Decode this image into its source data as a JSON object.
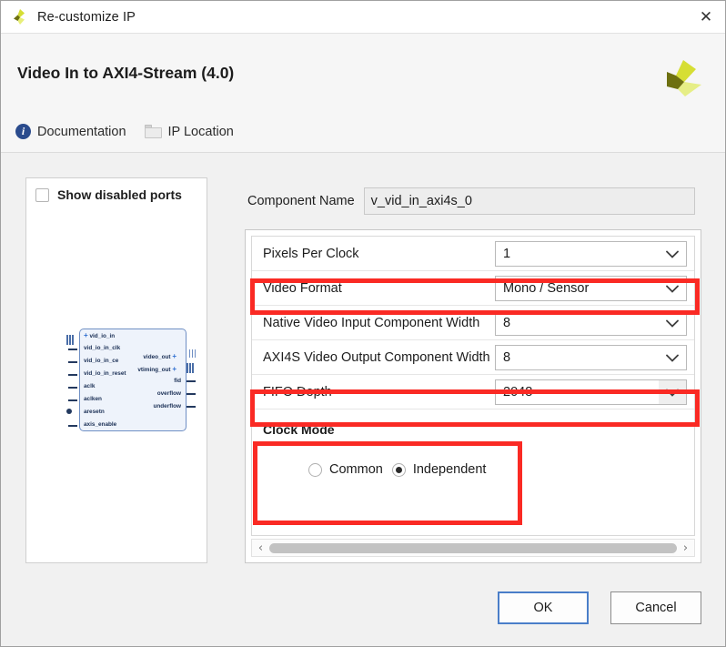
{
  "window": {
    "title": "Re-customize IP",
    "close_label": "✕",
    "logo_icon": "xilinx-logo-icon"
  },
  "header": {
    "ip_title": "Video In to AXI4-Stream (4.0)",
    "brand_icon": "xilinx-brand-icon",
    "links": [
      {
        "label": "Documentation",
        "icon": "info-icon"
      },
      {
        "label": "IP Location",
        "icon": "folder-icon"
      }
    ]
  },
  "left_panel": {
    "show_disabled_ports": {
      "label": "Show disabled ports",
      "checked": false
    },
    "diagram": {
      "inputs": [
        "vid_io_in",
        "vid_io_in_clk",
        "vid_io_in_ce",
        "vid_io_in_reset",
        "aclk",
        "aclken",
        "aresetn",
        "axis_enable"
      ],
      "outputs": [
        "video_out",
        "vtiming_out",
        "fid",
        "overflow",
        "underflow"
      ]
    }
  },
  "form": {
    "component_name": {
      "label": "Component Name",
      "value": "v_vid_in_axi4s_0"
    },
    "fields": [
      {
        "label": "Pixels Per Clock",
        "value": "1",
        "highlighted": false
      },
      {
        "label": "Video Format",
        "value": "Mono / Sensor",
        "highlighted": true
      },
      {
        "label": "Native Video Input Component Width",
        "value": "8",
        "highlighted": false
      },
      {
        "label": "AXI4S Video Output Component Width",
        "value": "8",
        "highlighted": false
      },
      {
        "label": "FIFO Depth",
        "value": "2048",
        "highlighted": true
      }
    ],
    "clock_mode": {
      "title": "Clock Mode",
      "options": [
        {
          "label": "Common",
          "selected": false
        },
        {
          "label": "Independent",
          "selected": true
        }
      ]
    },
    "scrollbar": {
      "left_arrow": "‹",
      "right_arrow": "›"
    }
  },
  "footer": {
    "ok_label": "OK",
    "cancel_label": "Cancel"
  },
  "colors": {
    "highlight": "#fa2a24",
    "accent_button": "#4a7ec9",
    "brand_yellow": "#d6de34",
    "brand_olive": "#6d7010"
  }
}
